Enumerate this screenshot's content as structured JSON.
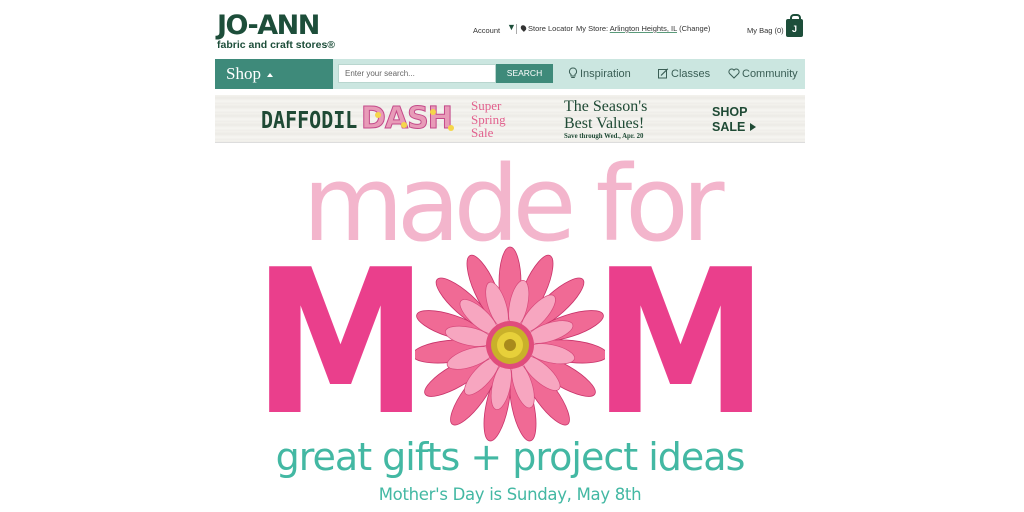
{
  "header": {
    "logo_main": "JO-ANN",
    "logo_sub": "fabric and craft stores®",
    "account_label": "Account",
    "store_locator_label": "Store Locator",
    "my_store_label": "My Store:",
    "my_store_name": "Arlington Heights, IL",
    "change_link": "(Change)",
    "bag_label": "My Bag (0)",
    "bag_icon_letter": "J"
  },
  "nav": {
    "shop_label": "Shop",
    "search_placeholder": "Enter your search...",
    "search_button": "SEARCH",
    "items": [
      {
        "label": "Inspiration",
        "icon": "lightbulb-icon"
      },
      {
        "label": "Classes",
        "icon": "pencil-note-icon"
      },
      {
        "label": "Community",
        "icon": "heart-icon"
      }
    ]
  },
  "promo": {
    "daffodil": "DAFFODIL",
    "dash": "DASH",
    "sale_line1": "Super",
    "sale_line2": "Spring",
    "sale_line3": "Sale",
    "season_line1": "The Season's",
    "season_line2": "Best Values!",
    "season_line3": "Save through Wed., Apr. 20",
    "shop_line1": "SHOP",
    "shop_line2": "SALE"
  },
  "hero": {
    "made_for": "made for",
    "mom_left": "M",
    "mom_right": "M",
    "tagline": "great gifts + project ideas",
    "subline": "Mother's Day is Sunday, May 8th"
  },
  "colors": {
    "brand_green": "#1d4e3a",
    "nav_teal": "#3e8a7a",
    "nav_bg": "#cbe6e0",
    "hero_pink_light": "#f3b5cc",
    "hero_pink": "#ea3f8c",
    "hero_teal": "#43b8a3"
  }
}
